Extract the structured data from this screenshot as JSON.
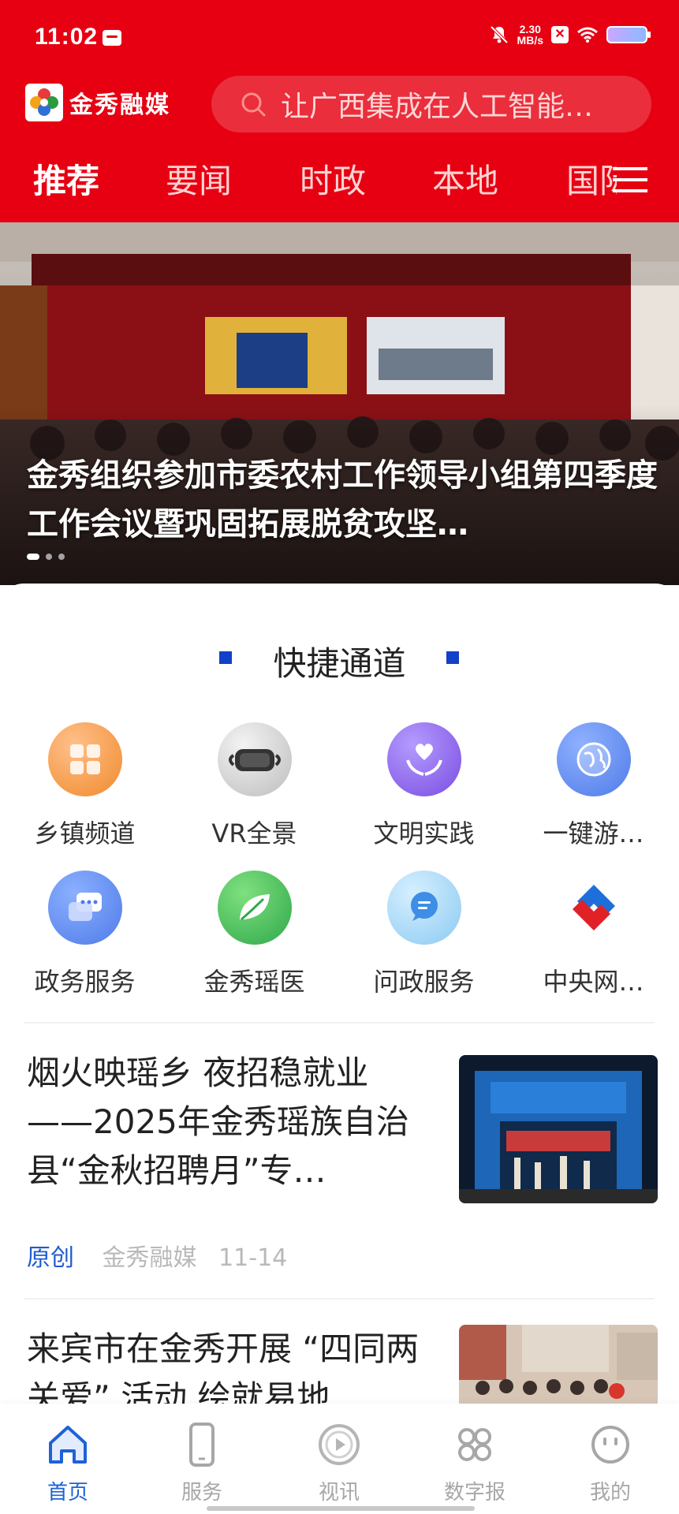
{
  "status_bar": {
    "time": "11:02",
    "net_speed_value": "2.30",
    "net_speed_unit": "MB/s"
  },
  "header": {
    "logo_text": "金秀融媒",
    "search_placeholder": "让广西集成在人工智能…",
    "tabs": [
      {
        "label": "推荐",
        "active": true
      },
      {
        "label": "要闻"
      },
      {
        "label": "时政"
      },
      {
        "label": "本地"
      },
      {
        "label": "国际"
      }
    ]
  },
  "banner": {
    "title": "金秀组织参加市委农村工作领导小组第四季度工作会议暨巩固拓展脱贫攻坚…",
    "slides": 3,
    "active_slide": 1
  },
  "quick_access": {
    "title": "快捷通道",
    "items": [
      {
        "label": "乡镇频道",
        "icon": "grid-icon"
      },
      {
        "label": "VR全景",
        "icon": "vr-headset-icon"
      },
      {
        "label": "文明实践",
        "icon": "heart-hands-icon"
      },
      {
        "label": "一键游…",
        "icon": "globe-icon"
      },
      {
        "label": "政务服务",
        "icon": "chat-bubbles-icon"
      },
      {
        "label": "金秀瑶医",
        "icon": "leaf-icon"
      },
      {
        "label": "问政服务",
        "icon": "message-icon"
      },
      {
        "label": "中央网…",
        "icon": "cctv-logo-icon"
      }
    ]
  },
  "news": [
    {
      "title": "烟火映瑶乡 夜招稳就业——2025年金秀瑶族自治县“金秋招聘月”专…",
      "tag": "原创",
      "source": "金秀融媒",
      "date": "11-14"
    },
    {
      "title": "来宾市在金秀开展 “四同两关爱” 活动 绘就易地"
    }
  ],
  "bottom_nav": [
    {
      "label": "首页",
      "icon": "home-icon",
      "active": true
    },
    {
      "label": "服务",
      "icon": "phone-icon"
    },
    {
      "label": "视讯",
      "icon": "play-icon"
    },
    {
      "label": "数字报",
      "icon": "apps-icon"
    },
    {
      "label": "我的",
      "icon": "smile-icon"
    }
  ],
  "colors": {
    "brand_red": "#e60012",
    "accent_blue": "#1e62d6"
  }
}
